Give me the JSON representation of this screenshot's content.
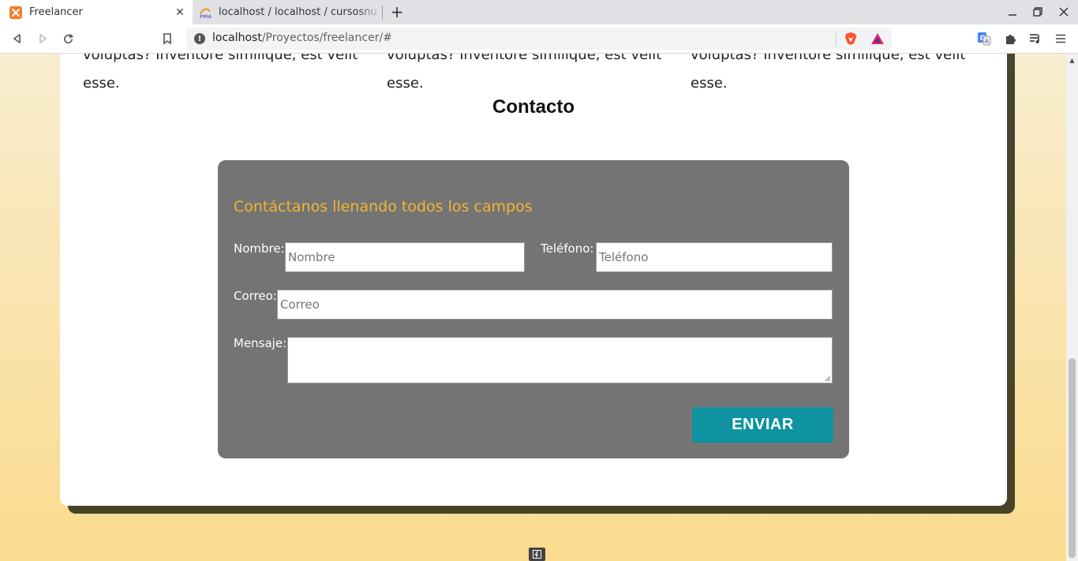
{
  "browser": {
    "tabs": [
      {
        "title": "Freelancer",
        "active": true,
        "icon": "xampp-icon"
      },
      {
        "title": "localhost / localhost / cursosnu",
        "active": false,
        "icon": "phpmyadmin-icon"
      }
    ],
    "url_host": "localhost",
    "url_path": "/Proyectos/freelancer/#"
  },
  "page": {
    "columns": [
      {
        "lines": [
          "voluptas? Inventore similique, est velit",
          "esse."
        ]
      },
      {
        "lines": [
          "voluptas? Inventore similique, est velit",
          "esse."
        ]
      },
      {
        "lines": [
          "voluptas? Inventore similique, est velit",
          "esse."
        ]
      }
    ],
    "contact": {
      "title": "Contacto",
      "heading": "Contáctanos llenando todos los campos",
      "name_label": "Nombre:",
      "name_placeholder": "Nombre",
      "phone_label": "Teléfono:",
      "phone_placeholder": "Teléfono",
      "email_label": "Correo:",
      "email_placeholder": "Correo",
      "message_label": "Mensaje:",
      "message_placeholder": "",
      "submit_label": "ENVIAR"
    }
  },
  "colors": {
    "form_bg": "#747474",
    "heading_accent": "#f2b533",
    "button_bg": "#0f93a1"
  }
}
